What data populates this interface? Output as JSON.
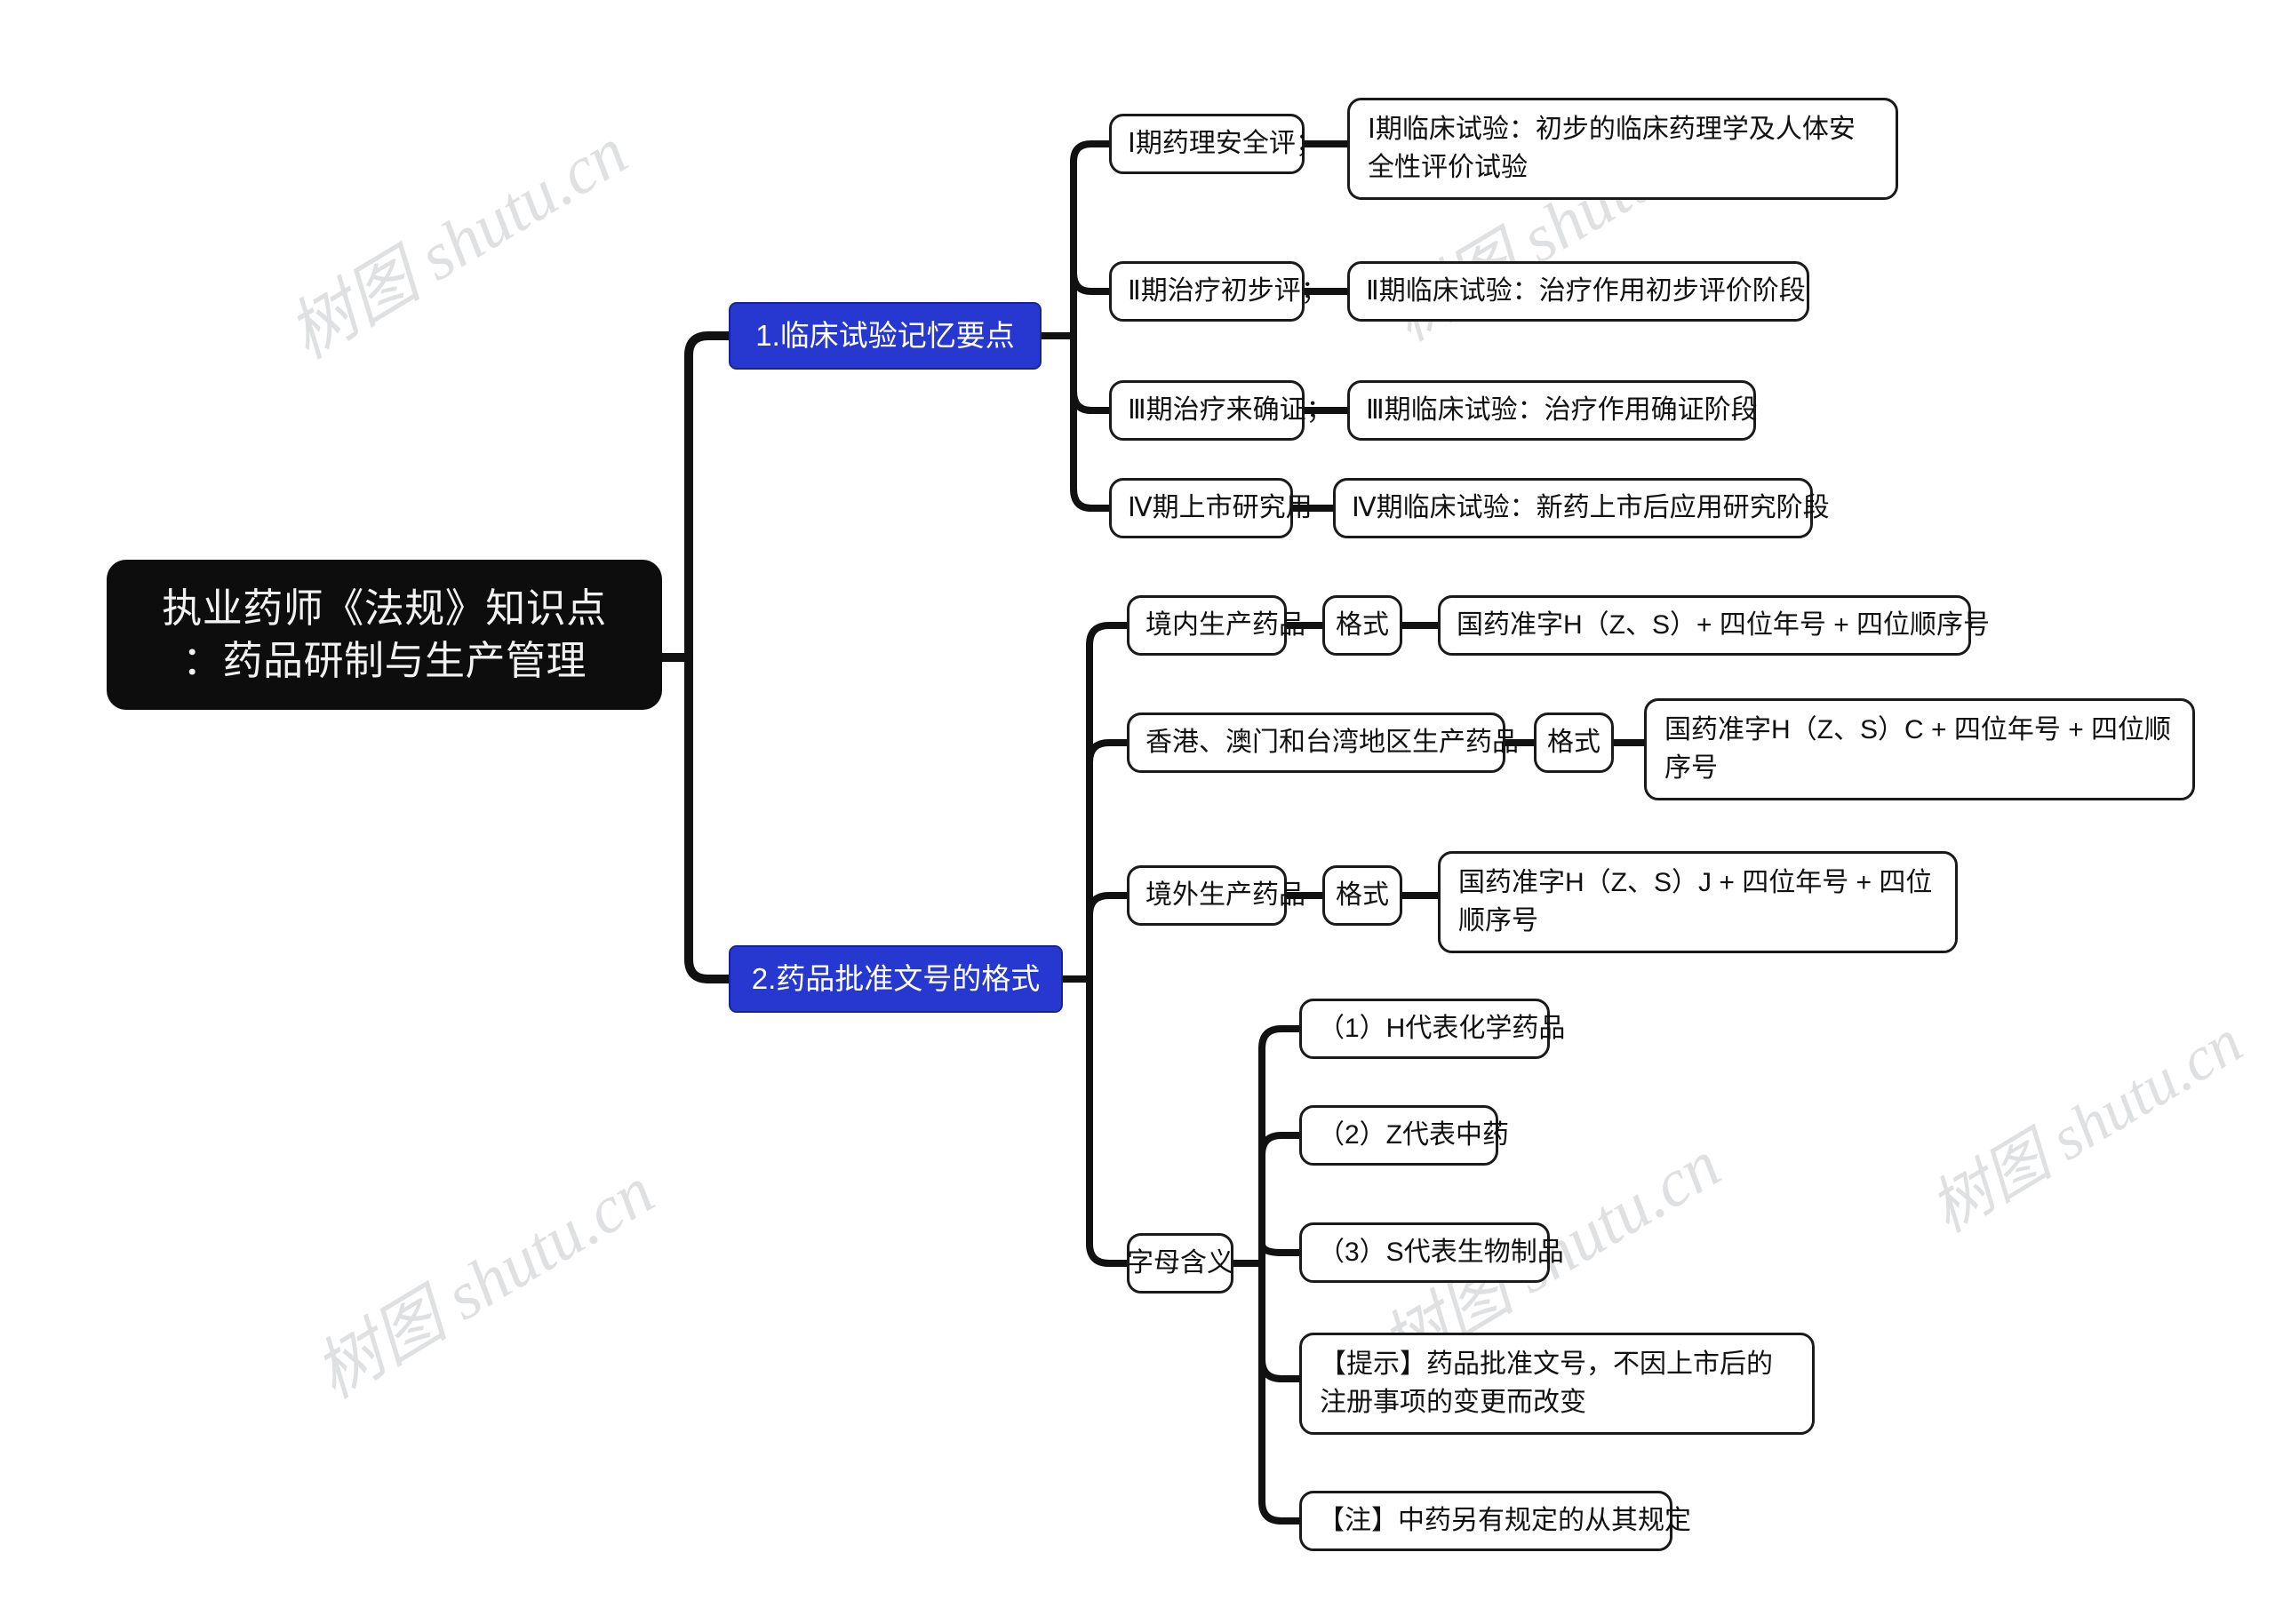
{
  "document": {
    "type": "mindmap",
    "background": "#ffffff",
    "root_color": "#0d0d0d",
    "branch_color": "#2638d0",
    "node_border_color": "#1a1a1a",
    "edge_color": "#111111"
  },
  "watermark": {
    "text": "树图 shutu.cn",
    "color": "#dfe0e2",
    "rotation_deg": -31
  },
  "root": {
    "label": "执业药师《法规》知识点：药品研制与生产管理",
    "line1": "执业药师《法规》知识点",
    "line2": "：药品研制与生产管理"
  },
  "branches": [
    {
      "id": "b1",
      "label": "1.临床试验记忆要点",
      "children": [
        {
          "label": "Ⅰ期药理安全评；",
          "detail": "Ⅰ期临床试验：初步的临床药理学及人体安全性评价试验"
        },
        {
          "label": "Ⅱ期治疗初步评；",
          "detail": "Ⅱ期临床试验：治疗作用初步评价阶段"
        },
        {
          "label": "Ⅲ期治疗来确证；",
          "detail": "Ⅲ期临床试验：治疗作用确证阶段"
        },
        {
          "label": "Ⅳ期上市研究用",
          "detail": "Ⅳ期临床试验：新药上市后应用研究阶段"
        }
      ]
    },
    {
      "id": "b2",
      "label": "2.药品批准文号的格式",
      "children": [
        {
          "label": "境内生产药品",
          "mid": "格式",
          "detail": "国药准字H（Z、S）+ 四位年号 + 四位顺序号"
        },
        {
          "label": "香港、澳门和台湾地区生产药品",
          "mid": "格式",
          "detail": "国药准字H（Z、S）C + 四位年号 + 四位顺序号"
        },
        {
          "label": "境外生产药品",
          "mid": "格式",
          "detail": "国药准字H（Z、S）J + 四位年号 + 四位顺序号"
        },
        {
          "label": "字母含义",
          "items": [
            "（1）H代表化学药品",
            "（2）Z代表中药",
            "（3）S代表生物制品",
            "【提示】药品批准文号，不因上市后的注册事项的变更而改变",
            "【注】中药另有规定的从其规定"
          ]
        }
      ]
    }
  ]
}
